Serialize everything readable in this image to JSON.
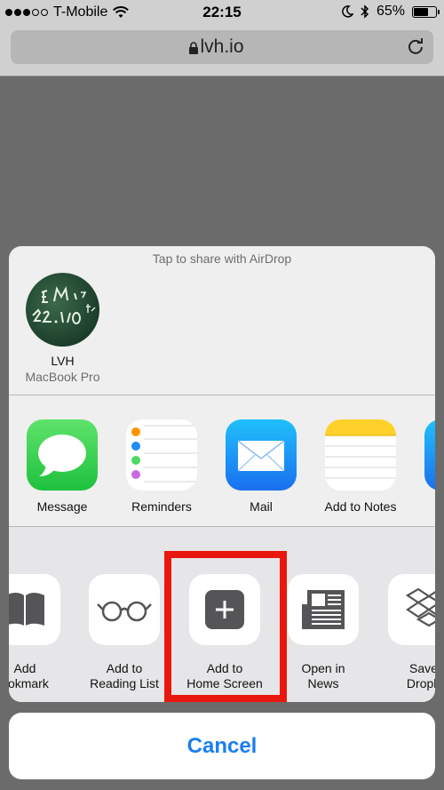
{
  "status_bar": {
    "carrier": "T-Mobile",
    "time": "22:15",
    "battery_percent": "65%",
    "battery_level": 0.65
  },
  "browser": {
    "url": "lvh.io"
  },
  "share_sheet": {
    "airdrop_title": "Tap to share with AirDrop",
    "airdrop_device": {
      "name": "LVH",
      "type": "MacBook Pro"
    },
    "apps": [
      {
        "label": "Message",
        "icon": "messages-icon",
        "color": "#31c84f"
      },
      {
        "label": "Reminders",
        "icon": "reminders-icon",
        "color": "#ffffff"
      },
      {
        "label": "Mail",
        "icon": "mail-icon",
        "color": "#1f8cf5"
      },
      {
        "label": "Add to Notes",
        "icon": "notes-icon",
        "color": "#ffd12a"
      }
    ],
    "actions": [
      {
        "line1": "Add",
        "line2": "ookmark",
        "icon": "book-icon"
      },
      {
        "line1": "Add to",
        "line2": "Reading List",
        "icon": "glasses-icon"
      },
      {
        "line1": "Add to",
        "line2": "Home Screen",
        "icon": "plus-square-icon"
      },
      {
        "line1": "Open in",
        "line2": "News",
        "icon": "news-icon"
      },
      {
        "line1": "Save",
        "line2": "Dropb",
        "icon": "dropbox-icon"
      }
    ]
  },
  "cancel_label": "Cancel",
  "colors": {
    "accent": "#1a7ef2",
    "highlight": "#e8180e",
    "dimmed_background": "#6b6b6b"
  }
}
